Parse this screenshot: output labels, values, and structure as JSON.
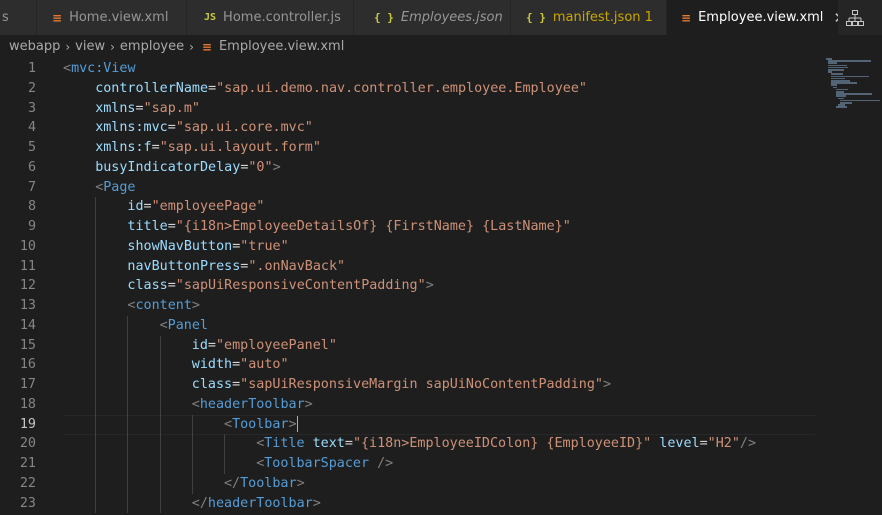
{
  "tabs": [
    {
      "label": "s",
      "icon": "none",
      "style": "partial"
    },
    {
      "label": "Home.view.xml",
      "icon": "xml-file-icon",
      "style": "normal"
    },
    {
      "label": "Home.controller.js",
      "icon": "js-file-icon",
      "style": "normal"
    },
    {
      "label": "Employees.json",
      "icon": "json-file-icon",
      "style": "italic"
    },
    {
      "label": "manifest.json 1",
      "icon": "json-file-icon",
      "style": "warning"
    },
    {
      "label": "Employee.view.xml",
      "icon": "xml-file-icon",
      "style": "active"
    }
  ],
  "icons": {
    "xml": "≡",
    "js": "JS",
    "json": "{ }",
    "close": "✕",
    "chevron": "›"
  },
  "breadcrumb": [
    "webapp",
    "view",
    "employee",
    "Employee.view.xml"
  ],
  "editor": {
    "current_line": 19,
    "lines": [
      {
        "n": "1",
        "indent": 0,
        "guides": [],
        "toks": [
          [
            "b",
            "<"
          ],
          [
            "t",
            "mvc:View"
          ]
        ]
      },
      {
        "n": "2",
        "indent": 1,
        "guides": [],
        "toks": [
          [
            "a",
            "controllerName"
          ],
          [
            "e",
            "="
          ],
          [
            "s",
            "\"sap.ui.demo.nav.controller.employee.Employee\""
          ]
        ]
      },
      {
        "n": "3",
        "indent": 1,
        "guides": [],
        "toks": [
          [
            "a",
            "xmlns"
          ],
          [
            "e",
            "="
          ],
          [
            "s",
            "\"sap.m\""
          ]
        ]
      },
      {
        "n": "4",
        "indent": 1,
        "guides": [],
        "toks": [
          [
            "a",
            "xmlns:mvc"
          ],
          [
            "e",
            "="
          ],
          [
            "s",
            "\"sap.ui.core.mvc\""
          ]
        ]
      },
      {
        "n": "5",
        "indent": 1,
        "guides": [],
        "toks": [
          [
            "a",
            "xmlns:f"
          ],
          [
            "e",
            "="
          ],
          [
            "s",
            "\"sap.ui.layout.form\""
          ]
        ]
      },
      {
        "n": "6",
        "indent": 1,
        "guides": [],
        "toks": [
          [
            "a",
            "busyIndicatorDelay"
          ],
          [
            "e",
            "="
          ],
          [
            "s",
            "\"0\""
          ],
          [
            "b",
            ">"
          ]
        ]
      },
      {
        "n": "7",
        "indent": 1,
        "guides": [],
        "toks": [
          [
            "b",
            "<"
          ],
          [
            "t",
            "Page"
          ]
        ]
      },
      {
        "n": "8",
        "indent": 2,
        "guides": [
          1
        ],
        "toks": [
          [
            "a",
            "id"
          ],
          [
            "e",
            "="
          ],
          [
            "s",
            "\"employeePage\""
          ]
        ]
      },
      {
        "n": "9",
        "indent": 2,
        "guides": [
          1
        ],
        "toks": [
          [
            "a",
            "title"
          ],
          [
            "e",
            "="
          ],
          [
            "s",
            "\"{i18n>EmployeeDetailsOf} {FirstName} {LastName}\""
          ]
        ]
      },
      {
        "n": "10",
        "indent": 2,
        "guides": [
          1
        ],
        "toks": [
          [
            "a",
            "showNavButton"
          ],
          [
            "e",
            "="
          ],
          [
            "s",
            "\"true\""
          ]
        ]
      },
      {
        "n": "11",
        "indent": 2,
        "guides": [
          1
        ],
        "toks": [
          [
            "a",
            "navButtonPress"
          ],
          [
            "e",
            "="
          ],
          [
            "s",
            "\".onNavBack\""
          ]
        ]
      },
      {
        "n": "12",
        "indent": 2,
        "guides": [
          1
        ],
        "toks": [
          [
            "a",
            "class"
          ],
          [
            "e",
            "="
          ],
          [
            "s",
            "\"sapUiResponsiveContentPadding\""
          ],
          [
            "b",
            ">"
          ]
        ]
      },
      {
        "n": "13",
        "indent": 2,
        "guides": [
          1
        ],
        "toks": [
          [
            "b",
            "<"
          ],
          [
            "t",
            "content"
          ],
          [
            "b",
            ">"
          ]
        ]
      },
      {
        "n": "14",
        "indent": 3,
        "guides": [
          1,
          2
        ],
        "toks": [
          [
            "b",
            "<"
          ],
          [
            "t",
            "Panel"
          ]
        ]
      },
      {
        "n": "15",
        "indent": 4,
        "guides": [
          1,
          2,
          3
        ],
        "toks": [
          [
            "a",
            "id"
          ],
          [
            "e",
            "="
          ],
          [
            "s",
            "\"employeePanel\""
          ]
        ]
      },
      {
        "n": "16",
        "indent": 4,
        "guides": [
          1,
          2,
          3
        ],
        "toks": [
          [
            "a",
            "width"
          ],
          [
            "e",
            "="
          ],
          [
            "s",
            "\"auto\""
          ]
        ]
      },
      {
        "n": "17",
        "indent": 4,
        "guides": [
          1,
          2,
          3
        ],
        "toks": [
          [
            "a",
            "class"
          ],
          [
            "e",
            "="
          ],
          [
            "s",
            "\"sapUiResponsiveMargin sapUiNoContentPadding\""
          ],
          [
            "b",
            ">"
          ]
        ]
      },
      {
        "n": "18",
        "indent": 4,
        "guides": [
          1,
          2,
          3
        ],
        "toks": [
          [
            "b",
            "<"
          ],
          [
            "t",
            "headerToolbar"
          ],
          [
            "b",
            ">"
          ]
        ]
      },
      {
        "n": "19",
        "indent": 5,
        "guides": [
          1,
          2,
          3,
          4
        ],
        "toks": [
          [
            "b",
            "<"
          ],
          [
            "t",
            "Toolbar"
          ],
          [
            "b",
            ">"
          ],
          [
            "c",
            ""
          ]
        ]
      },
      {
        "n": "20",
        "indent": 6,
        "guides": [
          1,
          2,
          3,
          4,
          5
        ],
        "toks": [
          [
            "b",
            "<"
          ],
          [
            "t",
            "Title"
          ],
          [
            "e",
            " "
          ],
          [
            "a",
            "text"
          ],
          [
            "e",
            "="
          ],
          [
            "s",
            "\"{i18n>EmployeeIDColon} {EmployeeID}\""
          ],
          [
            "e",
            " "
          ],
          [
            "a",
            "level"
          ],
          [
            "e",
            "="
          ],
          [
            "s",
            "\"H2\""
          ],
          [
            "b",
            "/>"
          ]
        ]
      },
      {
        "n": "21",
        "indent": 6,
        "guides": [
          1,
          2,
          3,
          4,
          5
        ],
        "toks": [
          [
            "b",
            "<"
          ],
          [
            "t",
            "ToolbarSpacer"
          ],
          [
            "e",
            " "
          ],
          [
            "b",
            "/>"
          ]
        ]
      },
      {
        "n": "22",
        "indent": 5,
        "guides": [
          1,
          2,
          3,
          4
        ],
        "toks": [
          [
            "b",
            "</"
          ],
          [
            "t",
            "Toolbar"
          ],
          [
            "b",
            ">"
          ]
        ]
      },
      {
        "n": "23",
        "indent": 4,
        "guides": [
          1,
          2,
          3
        ],
        "toks": [
          [
            "b",
            "</"
          ],
          [
            "t",
            "headerToolbar"
          ],
          [
            "b",
            ">"
          ]
        ]
      }
    ]
  }
}
